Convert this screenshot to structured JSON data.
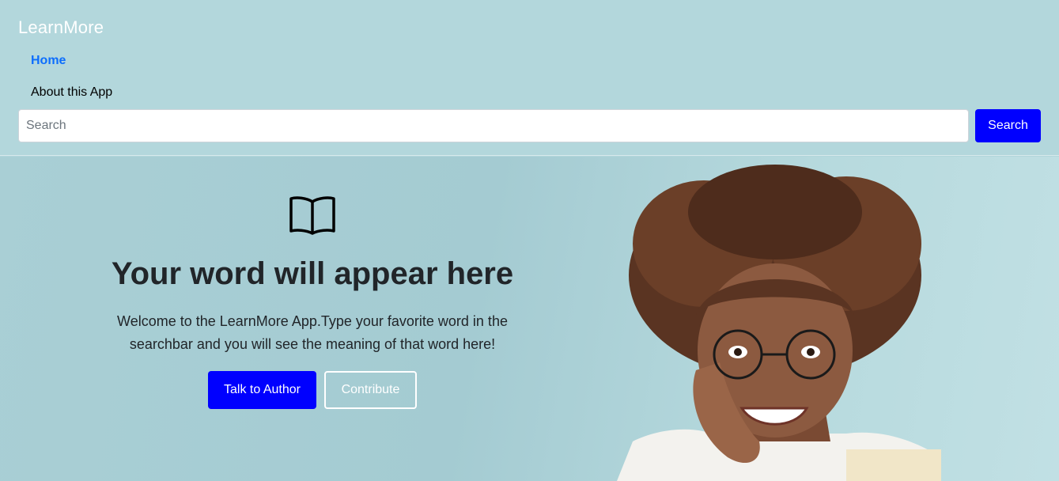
{
  "navbar": {
    "brand": "LearnMore",
    "links": [
      {
        "label": "Home",
        "active": true
      },
      {
        "label": "About this App",
        "active": false
      }
    ],
    "search": {
      "placeholder": "Search",
      "value": "",
      "button_label": "Search"
    }
  },
  "hero": {
    "icon": "book-icon",
    "title": "Your word will appear here",
    "text": "Welcome to the LearnMore App.Type your favorite word in the searchbar and you will see the meaning of that word here!",
    "buttons": {
      "primary": "Talk to Author",
      "secondary": "Contribute"
    }
  },
  "colors": {
    "background": "#b3d7dc",
    "accent": "#0000ff",
    "active_link": "#0d6efd",
    "heading": "#212529"
  }
}
